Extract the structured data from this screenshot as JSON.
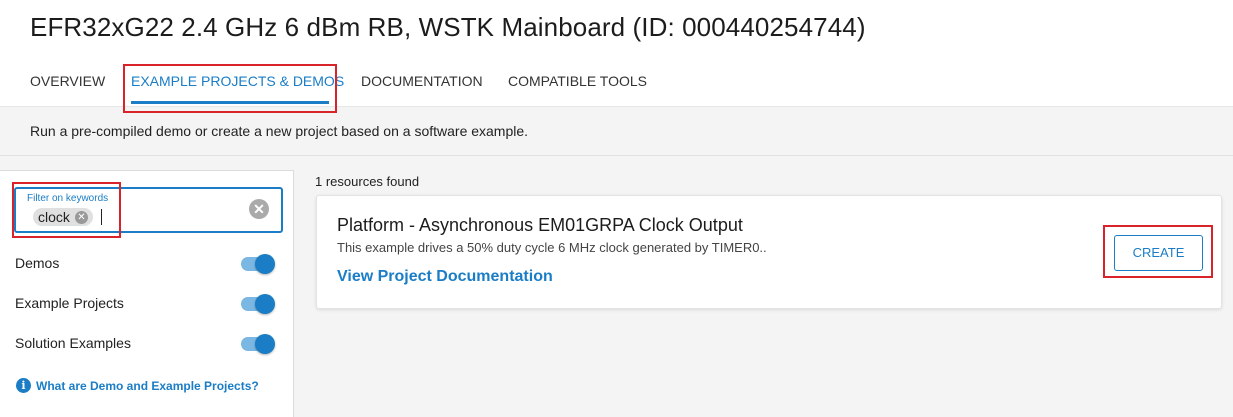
{
  "header": {
    "title": "EFR32xG22 2.4 GHz 6 dBm RB, WSTK Mainboard (ID: 000440254744)"
  },
  "tabs": [
    {
      "label": "OVERVIEW",
      "active": false
    },
    {
      "label": "EXAMPLE PROJECTS & DEMOS",
      "active": true
    },
    {
      "label": "DOCUMENTATION",
      "active": false
    },
    {
      "label": "COMPATIBLE TOOLS",
      "active": false
    }
  ],
  "subheader": {
    "text": "Run a pre-compiled demo or create a new project based on a software example."
  },
  "sidebar": {
    "filter": {
      "label": "Filter on keywords",
      "chip": "clock",
      "chip_close_icon": "close-circle-icon",
      "clear_icon": "clear-circle-icon"
    },
    "toggles": [
      {
        "label": "Demos",
        "on": true
      },
      {
        "label": "Example Projects",
        "on": true
      },
      {
        "label": "Solution Examples",
        "on": true
      }
    ],
    "help_link": {
      "icon": "info-icon",
      "label": "What are Demo and Example Projects?"
    }
  },
  "results": {
    "count_text": "1 resources found",
    "items": [
      {
        "title": "Platform - Asynchronous EM01GRPA Clock Output",
        "description": "This example drives a 50% duty cycle 6 MHz clock generated by TIMER0..",
        "link": "View Project Documentation",
        "button": "CREATE"
      }
    ]
  },
  "colors": {
    "accent": "#1a7dc6",
    "highlight_box": "#d8232a",
    "panel_bg": "#f4f4f4"
  }
}
